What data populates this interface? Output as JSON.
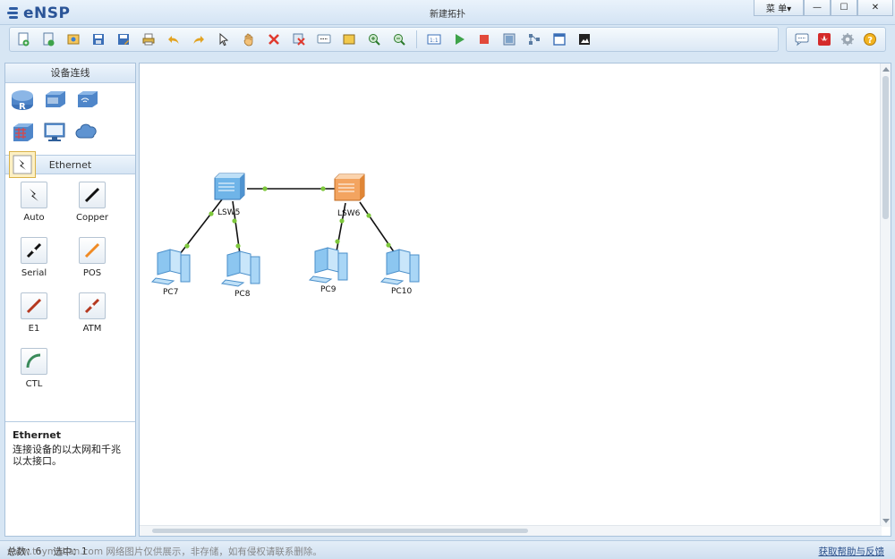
{
  "app": {
    "name": "eNSP",
    "window_title": "新建拓扑"
  },
  "window_controls": {
    "menu": "菜 单▾",
    "minimize": "—",
    "maximize": "☐",
    "close": "✕"
  },
  "toolbar": {
    "icons": [
      "new-topology-icon",
      "new-example-icon",
      "open-icon",
      "save-icon",
      "save-as-icon",
      "print-icon",
      "undo-icon",
      "redo-icon",
      "select-icon",
      "hand-icon",
      "delete-icon",
      "delete-all-icon",
      "text-icon",
      "rectangle-icon",
      "zoom-in-icon",
      "zoom-out-icon",
      "fit-icon",
      "start-device-icon",
      "stop-device-icon",
      "capture-icon",
      "topology-icon",
      "fullscreen-icon",
      "screenshot-icon"
    ],
    "right_icons": [
      "chat-icon",
      "huawei-icon",
      "settings-icon",
      "help-icon"
    ]
  },
  "left_panel": {
    "title": "设备连线",
    "categories": [
      {
        "name": "router",
        "icon": "router-icon"
      },
      {
        "name": "switch",
        "icon": "switch-icon"
      },
      {
        "name": "wireless",
        "icon": "wireless-icon"
      },
      {
        "name": "firewall",
        "icon": "firewall-icon"
      },
      {
        "name": "terminal",
        "icon": "pc-icon"
      },
      {
        "name": "cloud",
        "icon": "cloud-icon"
      },
      {
        "name": "cable",
        "icon": "cable-icon",
        "selected": true
      }
    ],
    "section": "Ethernet",
    "cables": [
      {
        "label": "Auto",
        "color": "#111111"
      },
      {
        "label": "Copper",
        "color": "#111111"
      },
      {
        "label": "Serial",
        "color": "#111111"
      },
      {
        "label": "POS",
        "color": "#f08a24"
      },
      {
        "label": "E1",
        "color": "#b5381f"
      },
      {
        "label": "ATM",
        "color": "#b5381f"
      },
      {
        "label": "CTL",
        "color": "#3a8a5a"
      }
    ],
    "description": {
      "title": "Ethernet",
      "text": "连接设备的以太网和千兆以太接口。"
    }
  },
  "topology": {
    "nodes": [
      {
        "id": "LSW5",
        "label": "LSW5",
        "type": "switch",
        "color": "#6fb4e8"
      },
      {
        "id": "LSW6",
        "label": "LSW6",
        "type": "switch",
        "color": "#f3a460"
      },
      {
        "id": "PC7",
        "label": "PC7",
        "type": "pc"
      },
      {
        "id": "PC8",
        "label": "PC8",
        "type": "pc"
      },
      {
        "id": "PC9",
        "label": "PC9",
        "type": "pc"
      },
      {
        "id": "PC10",
        "label": "PC10",
        "type": "pc"
      }
    ],
    "links": [
      {
        "from": "LSW5",
        "to": "LSW6"
      },
      {
        "from": "LSW5",
        "to": "PC7"
      },
      {
        "from": "LSW5",
        "to": "PC8"
      },
      {
        "from": "LSW6",
        "to": "PC9"
      },
      {
        "from": "LSW6",
        "to": "PC10"
      }
    ],
    "port_color": "#7ec83c"
  },
  "status_bar": {
    "total": "总数：6",
    "selected": "选中：1",
    "watermark": "www.toymoban.com 网络图片仅供展示，非存储，如有侵权请联系删除。",
    "feedback": "获取帮助与反馈"
  }
}
